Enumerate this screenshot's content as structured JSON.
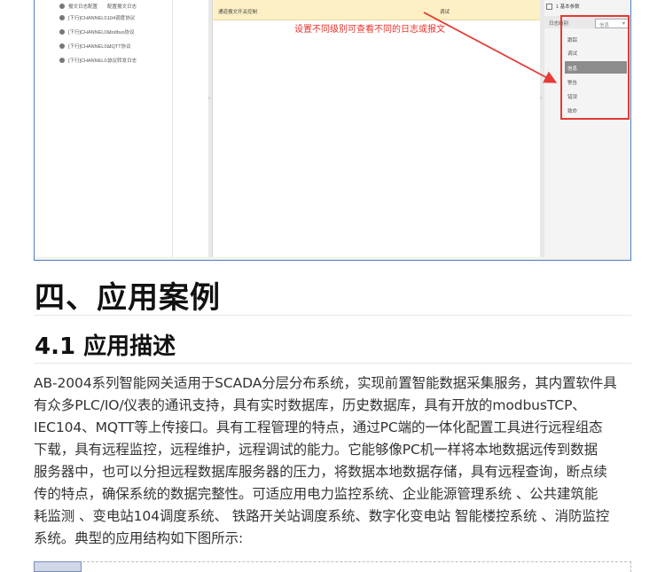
{
  "screenshot": {
    "tree_rows": [
      {
        "name": "报文日志配置",
        "desc": "配置报文日志"
      },
      {
        "name": "[下行]CHANNEL0...",
        "desc": "104调度协议"
      },
      {
        "name": "[下行]CHANNEL0...",
        "desc": "Modbus协议"
      },
      {
        "name": "[下行]CHANNEL0...",
        "desc": "MQTT协议"
      },
      {
        "name": "[下行]CHANNEL0...",
        "desc": "协议转发日志"
      }
    ],
    "grid_header_col1": "通道报文开关控制",
    "grid_header_col2": "调试",
    "annotation": "设置不同级别可查看不同的日志或报文",
    "property_group": "1 基本参数",
    "property_key": "日志级别",
    "property_value": "信息",
    "dropdown_arrow": "▾",
    "splitter_glyph": "‹",
    "splitter_glyph_right": "›",
    "dropdown_options": [
      "跟踪",
      "调试",
      "信息",
      "警告",
      "错误",
      "致命"
    ],
    "selected_option_index": 2,
    "colors": {
      "annotation": "#e8302a",
      "frame": "#4f7fbf"
    }
  },
  "article": {
    "heading1": "四、应用案例",
    "heading2": "4.1 应用描述",
    "paragraph_lines": [
      "AB-2004系列智能网关适用于SCADA分层分布系统，实现前置智能数据采集服务，其内置软件具",
      "有众多PLC/IO/仪表的通讯支持，具有实时数据库，历史数据库，具有开放的modbusTCP、",
      "IEC104、MQTT等上传接口。具有工程管理的特点，通过PC端的一体化配置工具进行远程组态",
      "下载，具有远程监控，远程维护，远程调试的能力。它能够像PC机一样将本地数据远传到数据",
      "服务器中，也可以分担远程数据库服务器的压力，将数据本地数据存储，具有远程查询，断点续",
      "传的特点，确保系统的数据完整性。可适应用电力监控系统、企业能源管理系统 、公共建筑能",
      "耗监测 、变电站104调度系统、 铁路开关站调度系统、数字化变电站 智能楼控系统 、消防监控",
      "系统。典型的应用结构如下图所示:"
    ]
  }
}
